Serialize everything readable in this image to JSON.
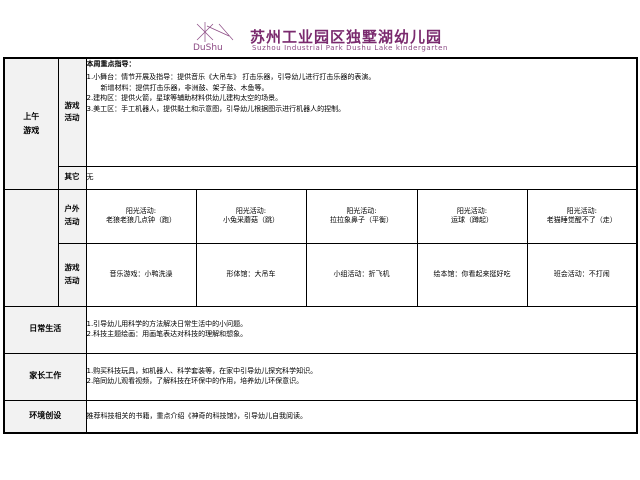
{
  "header": {
    "logo_mark": "DuShu",
    "org_name_cn": "苏州工业园区独墅湖幼儿园",
    "org_name_en": "Suzhou Industrial Park Dushu Lake kindergarten"
  },
  "morning_games": {
    "section_label": [
      "上午",
      "游戏"
    ],
    "games_label": [
      "游戏",
      "活动"
    ],
    "focus_title": "本周重点指导：",
    "focus_lines": [
      "1.小舞台：情节开展及指导：提供音乐《大吊车》 打击乐器，引导幼儿进行打击乐器的表演。",
      "新增材料：提供打击乐器，非洲鼓、架子鼓、木鱼等。",
      "2.建构区：提供火箭，星球等辅助材料供幼儿建构太空的场景。",
      "3.美工区：手工机器人，提供黏土和示意图，引导幼儿根据图示进行机器人的捏制。"
    ],
    "other_label": "其它",
    "other_value": "无"
  },
  "outdoor": {
    "label": [
      "户外",
      "活动"
    ],
    "cells": [
      {
        "title": "阳光活动:",
        "value": "老狼老狼几点钟（跑）"
      },
      {
        "title": "阳光活动:",
        "value": "小兔采蘑菇（跳）"
      },
      {
        "title": "阳光活动:",
        "value": "拉拉象鼻子（平衡）"
      },
      {
        "title": "阳光活动:",
        "value": "运球（蹲起）"
      },
      {
        "title": "阳光活动:",
        "value": "老猫睡觉醒不了（走）"
      }
    ]
  },
  "afternoon_games": {
    "label": [
      "游戏",
      "活动"
    ],
    "cells": [
      "音乐游戏：小鸭洗澡",
      "形体馆：大吊车",
      "小组活动：折飞机",
      "绘本馆：你看起来挺好吃",
      "班会活动：不打闹"
    ]
  },
  "daily_life": {
    "label": "日常生活",
    "lines": [
      "1.引导幼儿用科学的方法解决日常生活中的小问题。",
      "2.科技主题绘画：用画笔表达对科技的理解和想象。"
    ]
  },
  "parent_work": {
    "label": "家长工作",
    "lines": [
      "1.购买科技玩具，如机器人、科学套装等，在家中引导幼儿探究科学知识。",
      "2.陪同幼儿观看视频，了解科技在环保中的作用，培养幼儿环保意识。"
    ]
  },
  "environment": {
    "label": "环境创设",
    "text": "推荐科技相关的书籍，重点介绍《神奇的科技馆》，引导幼儿自我阅读。"
  },
  "colors": {
    "brand_purple": "#7a2a6e",
    "label_bg": "#f2f2f2",
    "border": "#000000"
  }
}
